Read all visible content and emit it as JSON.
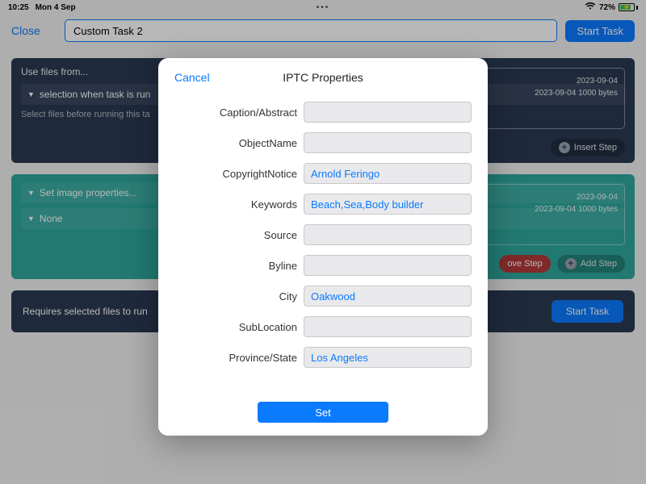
{
  "status": {
    "time": "10:25",
    "date": "Mon 4 Sep",
    "battery_pct": "72%"
  },
  "header": {
    "close": "Close",
    "task_name": "Custom Task 2",
    "start": "Start Task"
  },
  "panel1": {
    "title": "Use files from...",
    "dropdown": "selection when task is run",
    "hint": "Select files before running this ta",
    "info_line1": "2023-09-04",
    "info_line2": "2023-09-04  1000 bytes",
    "insert": "Insert Step"
  },
  "panel2": {
    "dropdown1": "Set image properties...",
    "dropdown2": "None",
    "info_line1": "2023-09-04",
    "info_line2": "2023-09-04  1000 bytes",
    "remove": "ove Step",
    "add": "Add Step"
  },
  "footer": {
    "text": "Requires selected files to run",
    "start": "Start Task"
  },
  "modal": {
    "cancel": "Cancel",
    "title": "IPTC Properties",
    "set": "Set",
    "fields": [
      {
        "label": "Caption/Abstract",
        "value": ""
      },
      {
        "label": "ObjectName",
        "value": ""
      },
      {
        "label": "CopyrightNotice",
        "value": "Arnold Feringo"
      },
      {
        "label": "Keywords",
        "value": "Beach,Sea,Body builder"
      },
      {
        "label": "Source",
        "value": ""
      },
      {
        "label": "Byline",
        "value": ""
      },
      {
        "label": "City",
        "value": "Oakwood"
      },
      {
        "label": "SubLocation",
        "value": ""
      },
      {
        "label": "Province/State",
        "value": "Los Angeles"
      }
    ]
  }
}
